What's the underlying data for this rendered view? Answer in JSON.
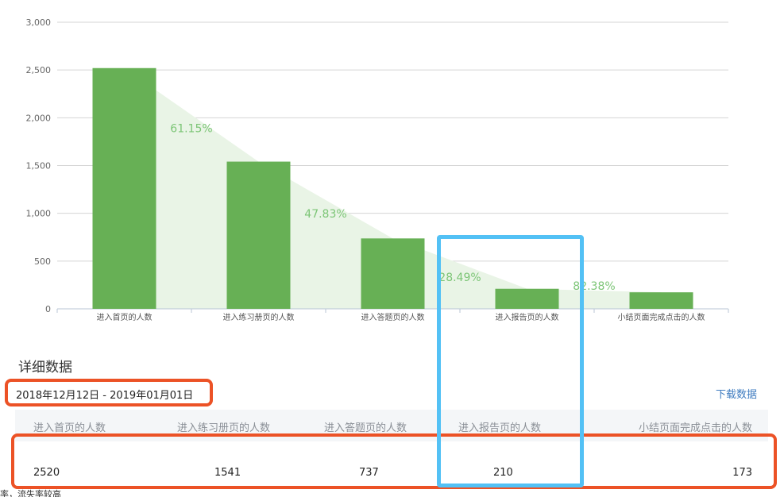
{
  "chart_data": {
    "type": "bar",
    "categories": [
      "进入首页的人数",
      "进入练习册页的人数",
      "进入答题页的人数",
      "进入报告页的人数",
      "小结页面完成点击的人数"
    ],
    "values": [
      2520,
      1541,
      737,
      210,
      173
    ],
    "conversion_rates": [
      "61.15%",
      "47.83%",
      "28.49%",
      "82.38%"
    ],
    "yticks": [
      0,
      500,
      1000,
      1500,
      2000,
      2500,
      3000
    ],
    "ytick_labels": [
      "0",
      "500",
      "1,000",
      "1,500",
      "2,000",
      "2,500",
      "3,000"
    ],
    "ylim": [
      0,
      3000
    ],
    "grid": true,
    "colors": {
      "bar": "#67b055",
      "area": "#e9f4e6",
      "rate_text": "#7cc576",
      "grid": "#d5d5d5"
    }
  },
  "detail": {
    "title": "详细数据",
    "date_range": "2018年12月12日 - 2019年01月01日",
    "download_label": "下载数据",
    "headers": [
      "进入首页的人数",
      "进入练习册页的人数",
      "进入答题页的人数",
      "进入报告页的人数",
      "小结页面完成点击的人数"
    ],
    "values": [
      "2520",
      "1541",
      "737",
      "210",
      "173"
    ]
  },
  "footer_partial_text": "率，流失率较高",
  "annotation_colors": {
    "red": "#ec5226",
    "blue": "#53c1f5"
  }
}
